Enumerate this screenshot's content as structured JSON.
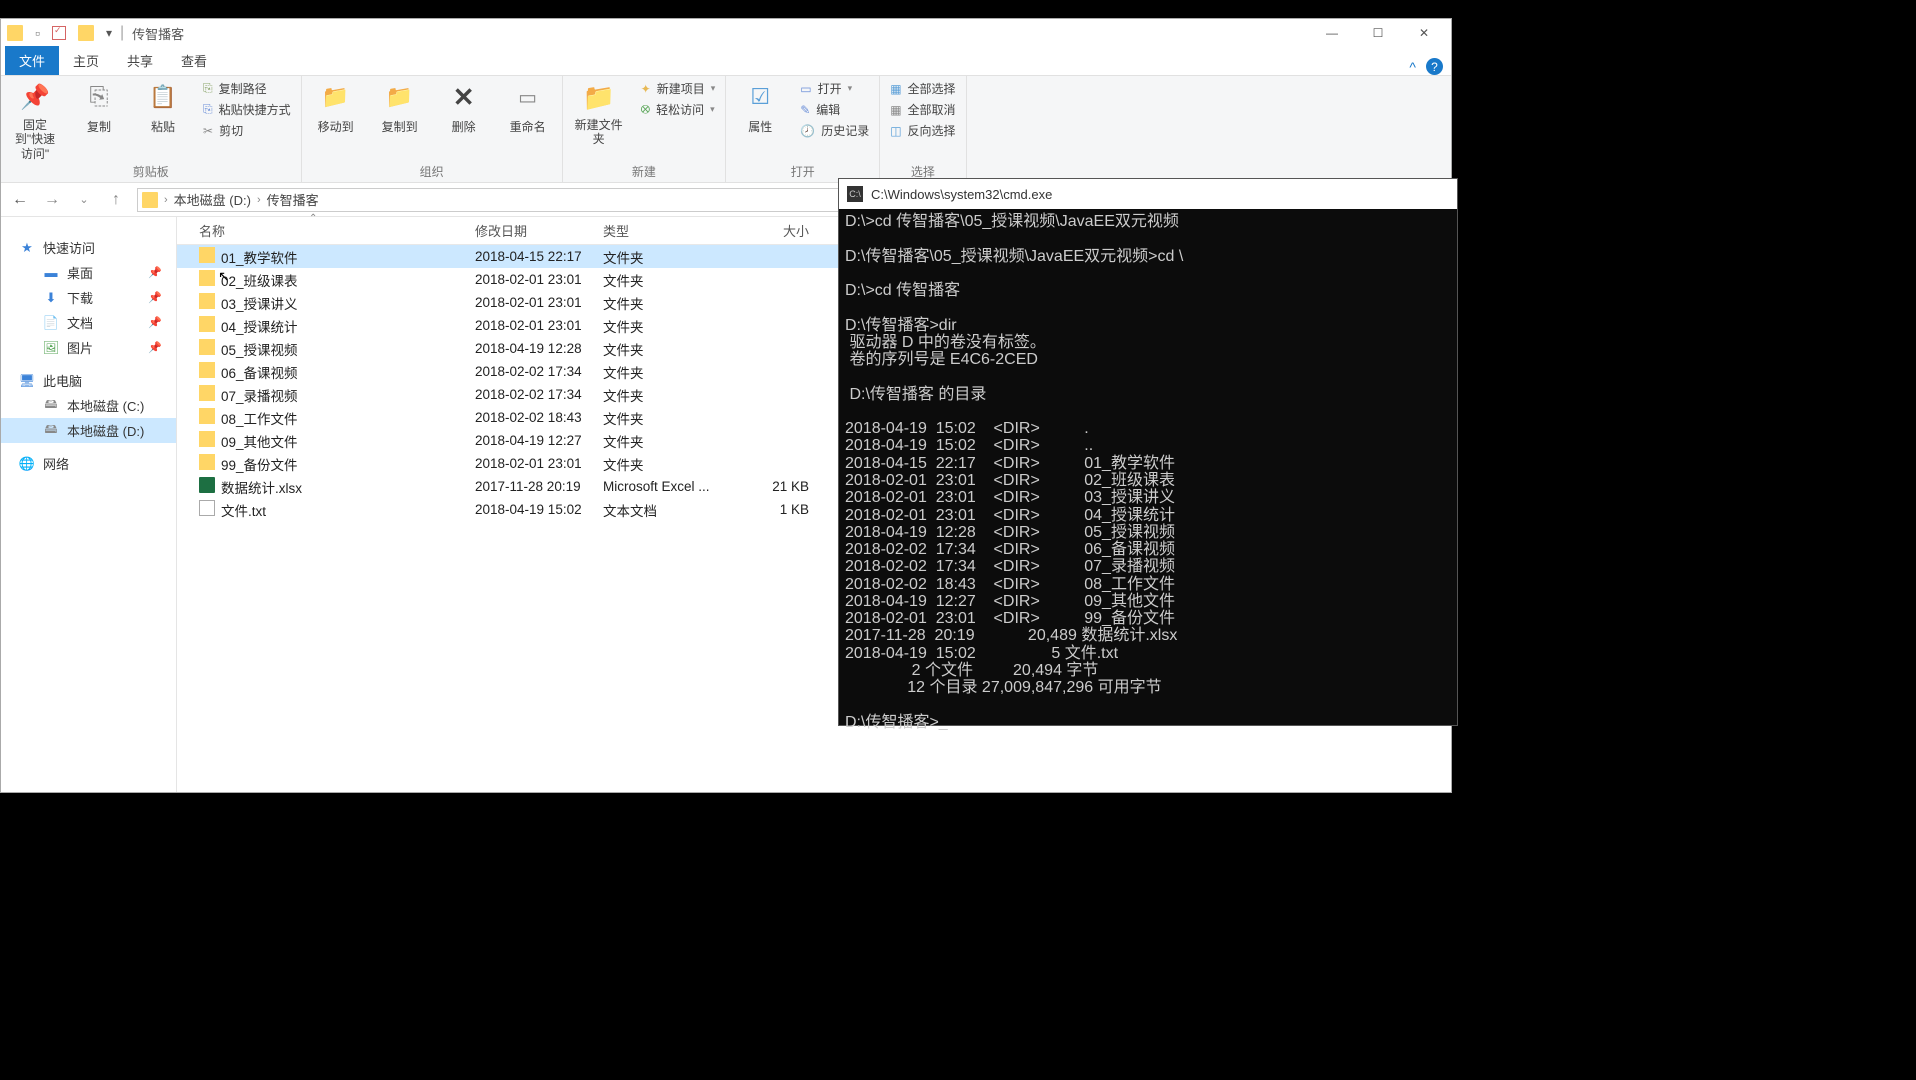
{
  "explorer": {
    "title": "传智播客",
    "tabs": {
      "file": "文件",
      "home": "主页",
      "share": "共享",
      "view": "查看"
    },
    "ribbon": {
      "pin": "固定到\"快速访问\"",
      "copy": "复制",
      "paste": "粘贴",
      "copy_path": "复制路径",
      "paste_shortcut": "粘贴快捷方式",
      "cut": "剪切",
      "clipboard_grp": "剪贴板",
      "move_to": "移动到",
      "copy_to": "复制到",
      "delete": "删除",
      "rename": "重命名",
      "organize_grp": "组织",
      "new_folder": "新建文件夹",
      "new_item": "新建项目",
      "easy_access": "轻松访问",
      "new_grp": "新建",
      "properties": "属性",
      "open": "打开",
      "edit": "编辑",
      "history": "历史记录",
      "open_grp": "打开",
      "select_all": "全部选择",
      "select_none": "全部取消",
      "invert": "反向选择",
      "select_grp": "选择"
    },
    "breadcrumbs": [
      "本地磁盘 (D:)",
      "传智播客"
    ],
    "sidebar": {
      "quick_access": "快速访问",
      "desktop": "桌面",
      "downloads": "下载",
      "documents": "文档",
      "pictures": "图片",
      "this_pc": "此电脑",
      "drive_c": "本地磁盘 (C:)",
      "drive_d": "本地磁盘 (D:)",
      "network": "网络"
    },
    "columns": {
      "name": "名称",
      "modified": "修改日期",
      "type": "类型",
      "size": "大小"
    },
    "files": [
      {
        "name": "01_教学软件",
        "date": "2018-04-15 22:17",
        "type": "文件夹",
        "size": "",
        "icon": "folder",
        "selected": true
      },
      {
        "name": "02_班级课表",
        "date": "2018-02-01 23:01",
        "type": "文件夹",
        "size": "",
        "icon": "folder"
      },
      {
        "name": "03_授课讲义",
        "date": "2018-02-01 23:01",
        "type": "文件夹",
        "size": "",
        "icon": "folder"
      },
      {
        "name": "04_授课统计",
        "date": "2018-02-01 23:01",
        "type": "文件夹",
        "size": "",
        "icon": "folder"
      },
      {
        "name": "05_授课视频",
        "date": "2018-04-19 12:28",
        "type": "文件夹",
        "size": "",
        "icon": "folder"
      },
      {
        "name": "06_备课视频",
        "date": "2018-02-02 17:34",
        "type": "文件夹",
        "size": "",
        "icon": "folder"
      },
      {
        "name": "07_录播视频",
        "date": "2018-02-02 17:34",
        "type": "文件夹",
        "size": "",
        "icon": "folder"
      },
      {
        "name": "08_工作文件",
        "date": "2018-02-02 18:43",
        "type": "文件夹",
        "size": "",
        "icon": "folder"
      },
      {
        "name": "09_其他文件",
        "date": "2018-04-19 12:27",
        "type": "文件夹",
        "size": "",
        "icon": "folder"
      },
      {
        "name": "99_备份文件",
        "date": "2018-02-01 23:01",
        "type": "文件夹",
        "size": "",
        "icon": "folder"
      },
      {
        "name": "数据统计.xlsx",
        "date": "2017-11-28 20:19",
        "type": "Microsoft Excel ...",
        "size": "21 KB",
        "icon": "xlsx"
      },
      {
        "name": "文件.txt",
        "date": "2018-04-19 15:02",
        "type": "文本文档",
        "size": "1 KB",
        "icon": "txt"
      }
    ]
  },
  "cmd": {
    "title": "C:\\Windows\\system32\\cmd.exe",
    "body": "D:\\>cd 传智播客\\05_授课视频\\JavaEE双元视频\n\nD:\\传智播客\\05_授课视频\\JavaEE双元视频>cd \\\n\nD:\\>cd 传智播客\n\nD:\\传智播客>dir\n 驱动器 D 中的卷没有标签。\n 卷的序列号是 E4C6-2CED\n\n D:\\传智播客 的目录\n\n2018-04-19  15:02    <DIR>          .\n2018-04-19  15:02    <DIR>          ..\n2018-04-15  22:17    <DIR>          01_教学软件\n2018-02-01  23:01    <DIR>          02_班级课表\n2018-02-01  23:01    <DIR>          03_授课讲义\n2018-02-01  23:01    <DIR>          04_授课统计\n2018-04-19  12:28    <DIR>          05_授课视频\n2018-02-02  17:34    <DIR>          06_备课视频\n2018-02-02  17:34    <DIR>          07_录播视频\n2018-02-02  18:43    <DIR>          08_工作文件\n2018-04-19  12:27    <DIR>          09_其他文件\n2018-02-01  23:01    <DIR>          99_备份文件\n2017-11-28  20:19            20,489 数据统计.xlsx\n2018-04-19  15:02                 5 文件.txt\n               2 个文件         20,494 字节\n              12 个目录 27,009,847,296 可用字节\n\nD:\\传智播客>_"
  }
}
